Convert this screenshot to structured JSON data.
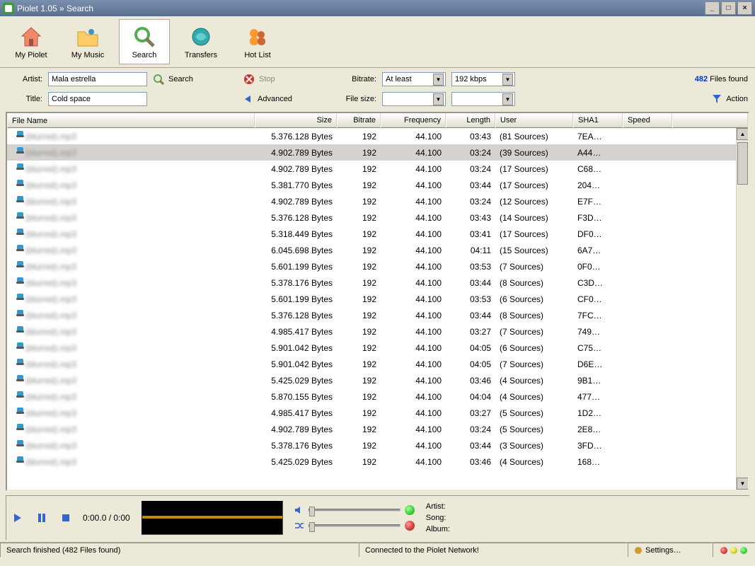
{
  "window": {
    "title": "Piolet 1.05 » Search"
  },
  "toolbar": {
    "my_piolet": "My Piolet",
    "my_music": "My Music",
    "search": "Search",
    "transfers": "Transfers",
    "hot_list": "Hot List"
  },
  "search": {
    "artist_label": "Artist:",
    "artist_value": "Mala estrella",
    "title_label": "Title:",
    "title_value": "Cold space",
    "search_btn": "Search",
    "stop_btn": "Stop",
    "advanced_btn": "Advanced",
    "bitrate_label": "Bitrate:",
    "bitrate_mode": "At least",
    "bitrate_value": "192 kbps",
    "filesize_label": "File size:",
    "filesize_mode": "",
    "filesize_value": "",
    "found_count": "482",
    "found_label": " Files found",
    "action_label": "Action"
  },
  "columns": {
    "name": "File Name",
    "size": "Size",
    "bitrate": "Bitrate",
    "frequency": "Frequency",
    "length": "Length",
    "user": "User",
    "sha1": "SHA1",
    "speed": "Speed"
  },
  "rows": [
    {
      "name": "(blurred).mp3",
      "size": "5.376.128 Bytes",
      "bitrate": "192",
      "freq": "44.100",
      "len": "03:43",
      "user": "(81 Sources)",
      "sha": "7EA…",
      "selected": false
    },
    {
      "name": "(blurred).mp3",
      "size": "4.902.789 Bytes",
      "bitrate": "192",
      "freq": "44.100",
      "len": "03:24",
      "user": "(39 Sources)",
      "sha": "A44…",
      "selected": true
    },
    {
      "name": "(blurred).mp3",
      "size": "4.902.789 Bytes",
      "bitrate": "192",
      "freq": "44.100",
      "len": "03:24",
      "user": "(17 Sources)",
      "sha": "C68…",
      "selected": false
    },
    {
      "name": "(blurred).mp3",
      "size": "5.381.770 Bytes",
      "bitrate": "192",
      "freq": "44.100",
      "len": "03:44",
      "user": "(17 Sources)",
      "sha": "204…",
      "selected": false
    },
    {
      "name": "(blurred).mp3",
      "size": "4.902.789 Bytes",
      "bitrate": "192",
      "freq": "44.100",
      "len": "03:24",
      "user": "(12 Sources)",
      "sha": "E7F…",
      "selected": false
    },
    {
      "name": "(blurred).mp3",
      "size": "5.376.128 Bytes",
      "bitrate": "192",
      "freq": "44.100",
      "len": "03:43",
      "user": "(14 Sources)",
      "sha": "F3D…",
      "selected": false
    },
    {
      "name": "(blurred).mp3",
      "size": "5.318.449 Bytes",
      "bitrate": "192",
      "freq": "44.100",
      "len": "03:41",
      "user": "(17 Sources)",
      "sha": "DF0…",
      "selected": false
    },
    {
      "name": "(blurred).mp3",
      "size": "6.045.698 Bytes",
      "bitrate": "192",
      "freq": "44.100",
      "len": "04:11",
      "user": "(15 Sources)",
      "sha": "6A7…",
      "selected": false
    },
    {
      "name": "(blurred).mp3",
      "size": "5.601.199 Bytes",
      "bitrate": "192",
      "freq": "44.100",
      "len": "03:53",
      "user": "(7 Sources)",
      "sha": "0F0…",
      "selected": false
    },
    {
      "name": "(blurred).mp3",
      "size": "5.378.176 Bytes",
      "bitrate": "192",
      "freq": "44.100",
      "len": "03:44",
      "user": "(8 Sources)",
      "sha": "C3D…",
      "selected": false
    },
    {
      "name": "(blurred).mp3",
      "size": "5.601.199 Bytes",
      "bitrate": "192",
      "freq": "44.100",
      "len": "03:53",
      "user": "(6 Sources)",
      "sha": "CF0…",
      "selected": false
    },
    {
      "name": "(blurred).mp3",
      "size": "5.376.128 Bytes",
      "bitrate": "192",
      "freq": "44.100",
      "len": "03:44",
      "user": "(8 Sources)",
      "sha": "7FC…",
      "selected": false
    },
    {
      "name": "(blurred).mp3",
      "size": "4.985.417 Bytes",
      "bitrate": "192",
      "freq": "44.100",
      "len": "03:27",
      "user": "(7 Sources)",
      "sha": "749…",
      "selected": false
    },
    {
      "name": "(blurred).mp3",
      "size": "5.901.042 Bytes",
      "bitrate": "192",
      "freq": "44.100",
      "len": "04:05",
      "user": "(6 Sources)",
      "sha": "C75…",
      "selected": false
    },
    {
      "name": "(blurred).mp3",
      "size": "5.901.042 Bytes",
      "bitrate": "192",
      "freq": "44.100",
      "len": "04:05",
      "user": "(7 Sources)",
      "sha": "D6E…",
      "selected": false
    },
    {
      "name": "(blurred).mp3",
      "size": "5.425.029 Bytes",
      "bitrate": "192",
      "freq": "44.100",
      "len": "03:46",
      "user": "(4 Sources)",
      "sha": "9B1…",
      "selected": false
    },
    {
      "name": "(blurred).mp3",
      "size": "5.870.155 Bytes",
      "bitrate": "192",
      "freq": "44.100",
      "len": "04:04",
      "user": "(4 Sources)",
      "sha": "477…",
      "selected": false
    },
    {
      "name": "(blurred).mp3",
      "size": "4.985.417 Bytes",
      "bitrate": "192",
      "freq": "44.100",
      "len": "03:27",
      "user": "(5 Sources)",
      "sha": "1D2…",
      "selected": false
    },
    {
      "name": "(blurred).mp3",
      "size": "4.902.789 Bytes",
      "bitrate": "192",
      "freq": "44.100",
      "len": "03:24",
      "user": "(5 Sources)",
      "sha": "2E8…",
      "selected": false
    },
    {
      "name": "(blurred).mp3",
      "size": "5.378.176 Bytes",
      "bitrate": "192",
      "freq": "44.100",
      "len": "03:44",
      "user": "(3 Sources)",
      "sha": "3FD…",
      "selected": false
    },
    {
      "name": "(blurred).mp3",
      "size": "5.425.029 Bytes",
      "bitrate": "192",
      "freq": "44.100",
      "len": "03:46",
      "user": "(4 Sources)",
      "sha": "168…",
      "selected": false
    }
  ],
  "player": {
    "time": "0:00.0 / 0:00",
    "artist_label": "Artist:",
    "song_label": "Song:",
    "album_label": "Album:"
  },
  "status": {
    "left": "Search finished (482 Files found)",
    "mid": "Connected to the Piolet Network!",
    "settings": "Settings…"
  }
}
